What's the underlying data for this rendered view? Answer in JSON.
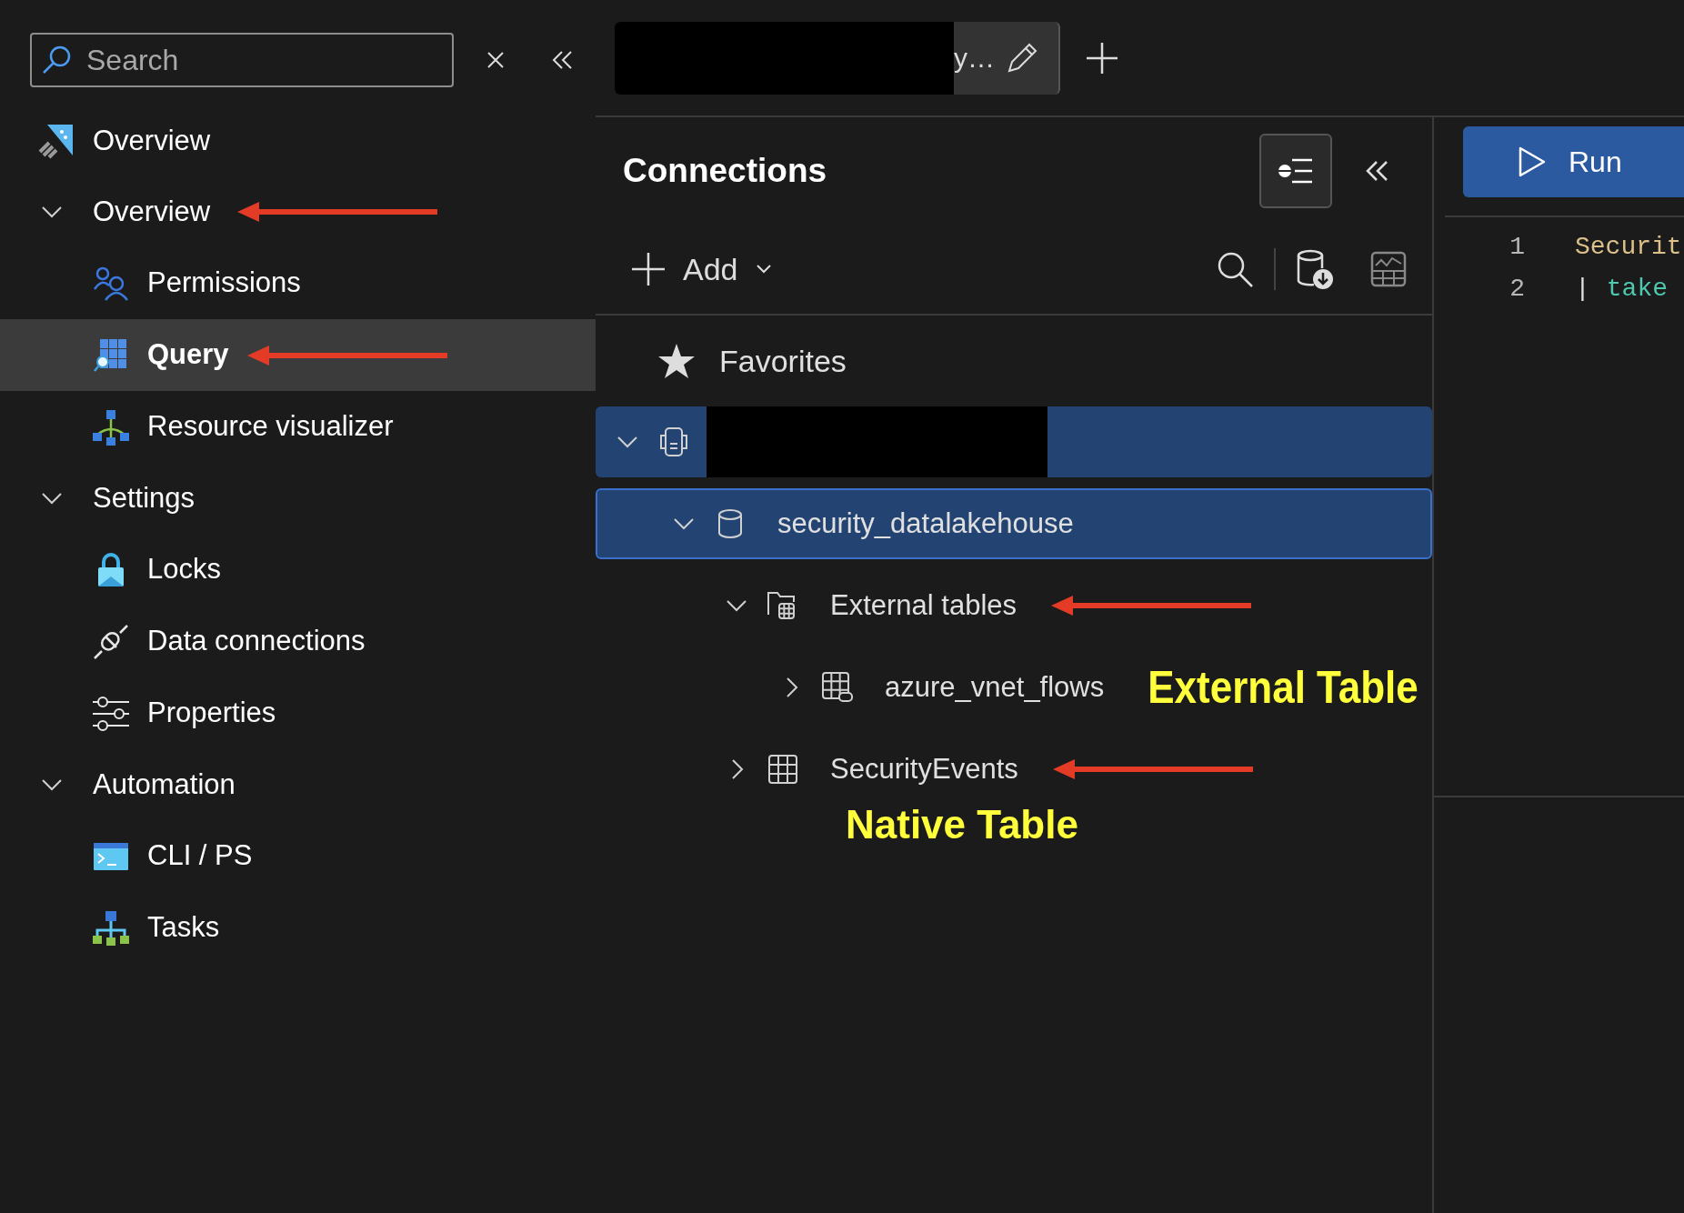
{
  "sidebar": {
    "search": {
      "placeholder": "Search"
    },
    "items": [
      {
        "label": "Overview",
        "selected": false,
        "arrow": false
      },
      {
        "label": "Overview",
        "expanded": true,
        "arrow": true,
        "children": [
          {
            "label": "Permissions",
            "selected": false,
            "arrow": false
          },
          {
            "label": "Query",
            "selected": true,
            "arrow": true
          },
          {
            "label": "Resource visualizer",
            "selected": false,
            "arrow": false
          }
        ]
      },
      {
        "label": "Settings",
        "expanded": true,
        "arrow": false,
        "children": [
          {
            "label": "Locks",
            "selected": false,
            "arrow": false
          },
          {
            "label": "Data connections",
            "selected": false,
            "arrow": false
          },
          {
            "label": "Properties",
            "selected": false,
            "arrow": false
          }
        ]
      },
      {
        "label": "Automation",
        "expanded": true,
        "arrow": false,
        "children": [
          {
            "label": "CLI / PS",
            "selected": false,
            "arrow": false
          },
          {
            "label": "Tasks",
            "selected": false,
            "arrow": false
          }
        ]
      }
    ]
  },
  "tab": {
    "title": "y…",
    "redacted": true
  },
  "connections": {
    "title": "Connections",
    "add_label": "Add",
    "favorites": "Favorites",
    "tree": [
      {
        "kind": "cluster",
        "redacted": true,
        "expanded": true,
        "selected": false,
        "children": [
          {
            "kind": "database",
            "label": "security_datalakehouse",
            "expanded": true,
            "selected": true,
            "children": [
              {
                "kind": "folder",
                "label": "External tables",
                "expanded": true,
                "selected": false,
                "arrow": true,
                "children": [
                  {
                    "kind": "external-table",
                    "label": "azure_vnet_flows",
                    "expanded": false,
                    "selected": false,
                    "note": "External Table"
                  }
                ]
              },
              {
                "kind": "table",
                "label": "SecurityEvents",
                "expanded": false,
                "selected": false,
                "arrow": true,
                "note_below": "Native Table"
              }
            ]
          }
        ]
      }
    ]
  },
  "editor": {
    "run_label": "Run",
    "lines": [
      {
        "number": "1",
        "tokens": [
          {
            "kind": "identifier",
            "text": "Securit"
          }
        ]
      },
      {
        "number": "2",
        "tokens": [
          {
            "kind": "operator",
            "text": "|"
          },
          {
            "kind": "keyword",
            "text": "take"
          }
        ]
      }
    ]
  }
}
